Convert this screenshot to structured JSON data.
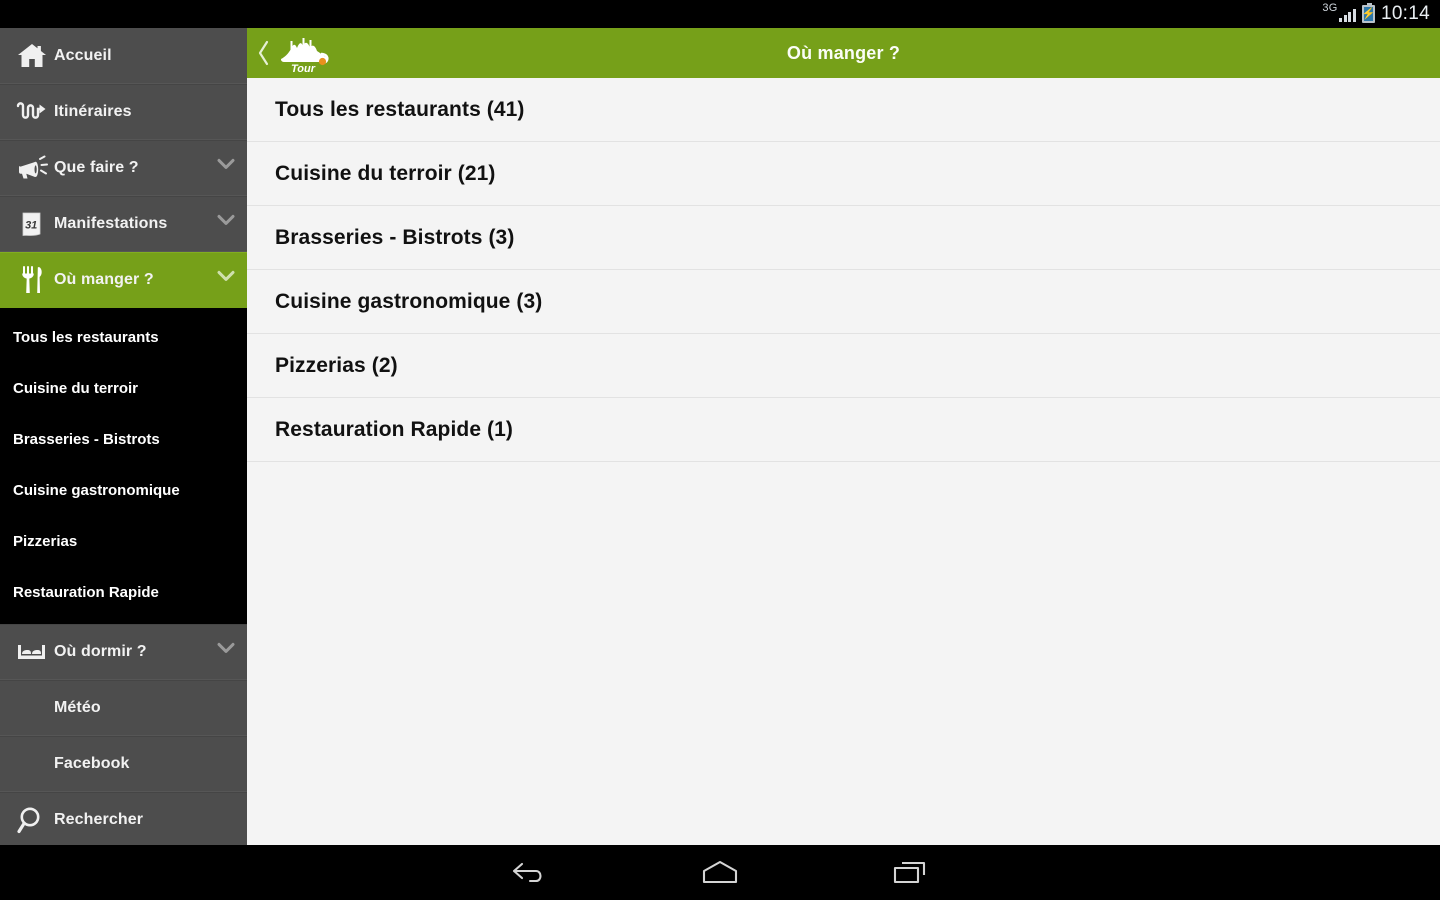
{
  "statusbar": {
    "network": "3G",
    "time": "10:14",
    "battery_icon": "battery-charging-icon",
    "signal_icon": "signal-bars-icon"
  },
  "topbar": {
    "back_icon": "back-chevron-icon",
    "logo_icon": "tour-skyline-logo",
    "logo_text": "Tour",
    "title": "Où manger ?",
    "green": "#76a019"
  },
  "sidebar": {
    "items": [
      {
        "label": "Accueil",
        "icon": "home-icon",
        "expandable": false,
        "active": false
      },
      {
        "label": "Itinéraires",
        "icon": "route-icon",
        "expandable": false,
        "active": false
      },
      {
        "label": "Que faire ?",
        "icon": "megaphone-icon",
        "expandable": true,
        "active": false
      },
      {
        "label": "Manifestations",
        "icon": "calendar-icon",
        "expandable": true,
        "active": false
      },
      {
        "label": "Où manger ?",
        "icon": "cutlery-icon",
        "expandable": true,
        "active": true
      }
    ],
    "submenu": [
      {
        "label": "Tous les restaurants"
      },
      {
        "label": "Cuisine du terroir"
      },
      {
        "label": "Brasseries - Bistrots"
      },
      {
        "label": "Cuisine gastronomique"
      },
      {
        "label": "Pizzerias"
      },
      {
        "label": "Restauration Rapide"
      }
    ],
    "items_after": [
      {
        "label": "Où dormir ?",
        "icon": "bed-icon",
        "expandable": true,
        "active": false,
        "indent": false
      },
      {
        "label": "Météo",
        "icon": "",
        "expandable": false,
        "active": false,
        "indent": true
      },
      {
        "label": "Facebook",
        "icon": "",
        "expandable": false,
        "active": false,
        "indent": true
      },
      {
        "label": "Rechercher",
        "icon": "search-icon",
        "expandable": false,
        "active": false,
        "indent": false
      }
    ]
  },
  "main": {
    "rows": [
      {
        "label": "Tous les restaurants (41)"
      },
      {
        "label": "Cuisine du terroir (21)"
      },
      {
        "label": "Brasseries - Bistrots (3)"
      },
      {
        "label": "Cuisine gastronomique (3)"
      },
      {
        "label": "Pizzerias (2)"
      },
      {
        "label": "Restauration Rapide (1)"
      }
    ]
  },
  "navbar": {
    "buttons": [
      {
        "icon": "back-icon"
      },
      {
        "icon": "home-icon"
      },
      {
        "icon": "recents-icon"
      }
    ]
  }
}
